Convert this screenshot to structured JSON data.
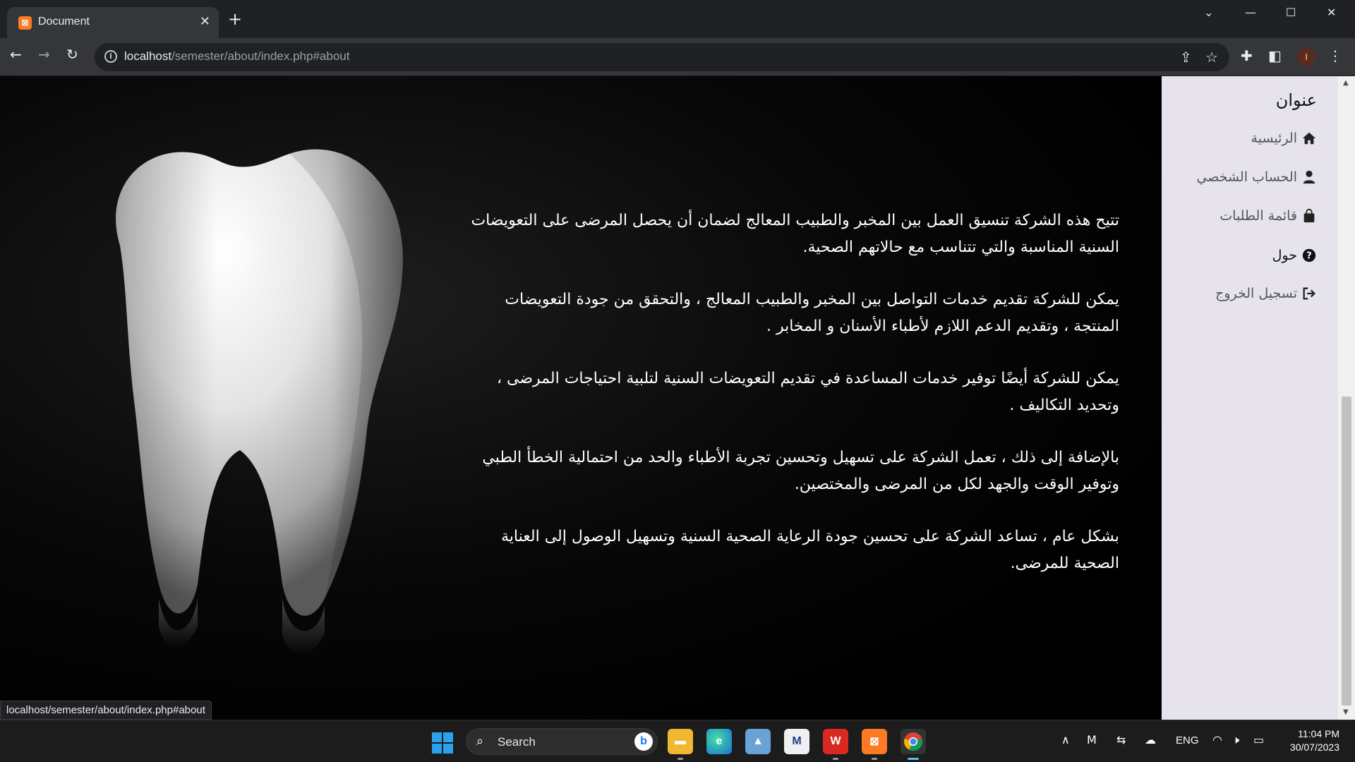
{
  "browser": {
    "tab_title": "Document",
    "url_host": "localhost",
    "url_path": "/semester/about/index.php#about",
    "profile_initial": "I"
  },
  "sidebar": {
    "title": "عنوان",
    "items": [
      {
        "label": "الرئيسية",
        "icon": "home-icon"
      },
      {
        "label": "الحساب الشخصي",
        "icon": "user-icon"
      },
      {
        "label": "قائمة الطلبات",
        "icon": "bag-icon"
      },
      {
        "label": "حول",
        "icon": "question-circle-icon"
      },
      {
        "label": "تسجيل الخروج",
        "icon": "logout-icon"
      }
    ]
  },
  "about": {
    "paragraphs": [
      "تتيح هذه الشركة تنسيق العمل بين المخبر والطبيب المعالج لضمان أن يحصل المرضى على التعويضات السنية المناسبة والتي تتناسب مع حالاتهم الصحية.",
      "يمكن للشركة تقديم خدمات التواصل بين المخبر والطبيب المعالج ، والتحقق من جودة التعويضات المنتجة ، وتقديم الدعم اللازم لأطباء الأسنان و المخابر .",
      "يمكن للشركة أيضًا توفير خدمات المساعدة في تقديم التعويضات السنية لتلبية احتياجات المرضى ، وتحديد التكاليف .",
      "بالإضافة إلى ذلك ، تعمل الشركة على تسهيل وتحسين تجربة الأطباء والحد من احتمالية الخطأ الطبي وتوفير الوقت والجهد لكل من المرضى والمختصين.",
      "بشكل عام ، تساعد الشركة على تحسين جودة الرعاية الصحية السنية وتسهيل الوصول إلى العناية الصحية للمرضى."
    ]
  },
  "status_url": "localhost/semester/about/index.php#about",
  "taskbar": {
    "search_label": "Search",
    "language": "ENG",
    "time": "11:04 PM",
    "date": "30/07/2023"
  },
  "colors": {
    "sidebar_bg": "#e6e3ed",
    "accent": "#4cc2ff",
    "xampp": "#fb7a24"
  }
}
